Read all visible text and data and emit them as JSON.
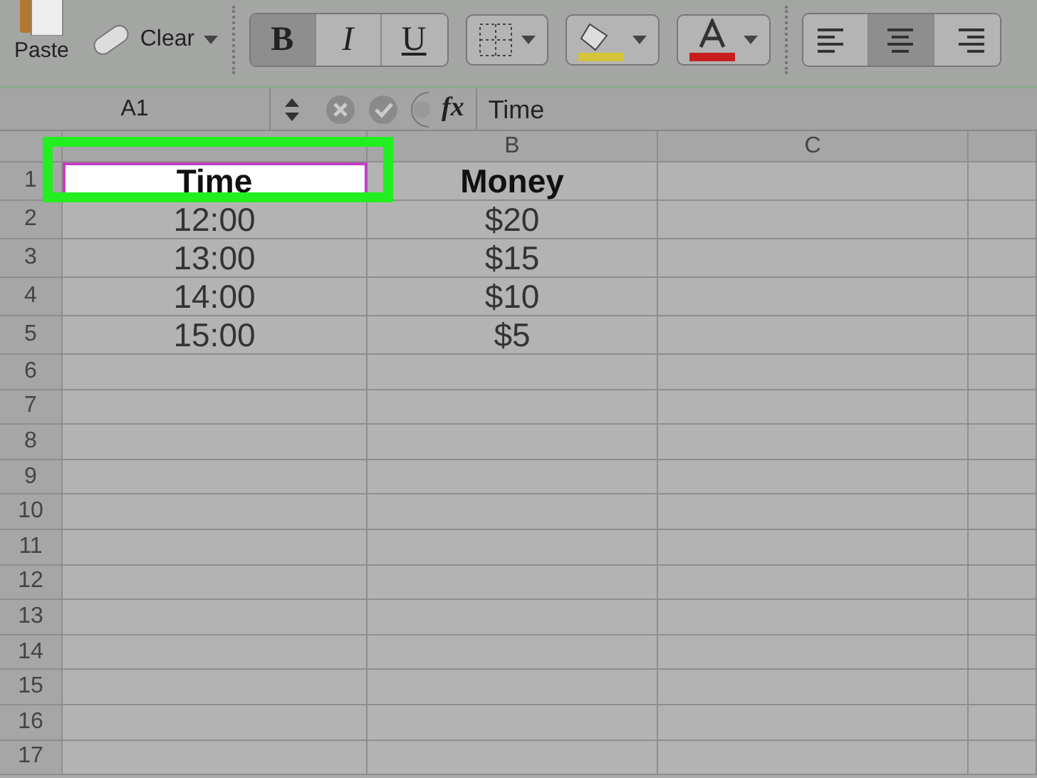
{
  "toolbar": {
    "paste": {
      "label": "Paste"
    },
    "clear": {
      "label": "Clear"
    },
    "format_buttons": [
      {
        "label": "B",
        "selected": true
      },
      {
        "label": "I",
        "selected": false
      },
      {
        "label": "U",
        "selected": false
      }
    ],
    "fill_color": {
      "color": "#d4c43a"
    },
    "font_color": {
      "color": "#c81e1e"
    },
    "align_buttons": [
      {
        "kind": "left",
        "selected": false
      },
      {
        "kind": "center",
        "selected": true
      },
      {
        "kind": "right",
        "selected": false
      }
    ]
  },
  "formula_bar": {
    "name_box": "A1",
    "fx": "fx",
    "value": "Time"
  },
  "sheet": {
    "columns": [
      {},
      {
        "label": "B"
      },
      {
        "label": "C"
      },
      {}
    ],
    "header_row": {
      "number": "1",
      "cells": [
        {
          "text": "Time",
          "selected": true
        },
        {
          "text": "Money",
          "selected": false
        },
        {
          "text": "",
          "selected": false
        },
        {
          "text": "",
          "selected": false
        }
      ]
    },
    "rows": [
      {
        "number": "2",
        "cells": [
          "12:00",
          "$20",
          "",
          ""
        ]
      },
      {
        "number": "3",
        "cells": [
          "13:00",
          "$15",
          "",
          ""
        ]
      },
      {
        "number": "4",
        "cells": [
          "14:00",
          "$10",
          "",
          ""
        ]
      },
      {
        "number": "5",
        "cells": [
          "15:00",
          "$5",
          "",
          ""
        ]
      },
      {
        "number": "6",
        "cells": [
          "",
          "",
          "",
          ""
        ]
      },
      {
        "number": "7",
        "cells": [
          "",
          "",
          "",
          ""
        ]
      },
      {
        "number": "8",
        "cells": [
          "",
          "",
          "",
          ""
        ]
      },
      {
        "number": "9",
        "cells": [
          "",
          "",
          "",
          ""
        ]
      },
      {
        "number": "10",
        "cells": [
          "",
          "",
          "",
          ""
        ]
      },
      {
        "number": "11",
        "cells": [
          "",
          "",
          "",
          ""
        ]
      },
      {
        "number": "12",
        "cells": [
          "",
          "",
          "",
          ""
        ]
      },
      {
        "number": "13",
        "cells": [
          "",
          "",
          "",
          ""
        ]
      },
      {
        "number": "14",
        "cells": [
          "",
          "",
          "",
          ""
        ]
      },
      {
        "number": "15",
        "cells": [
          "",
          "",
          "",
          ""
        ]
      },
      {
        "number": "16",
        "cells": [
          "",
          "",
          "",
          ""
        ]
      },
      {
        "number": "17",
        "cells": [
          "",
          "",
          "",
          ""
        ]
      }
    ],
    "highlight": true
  }
}
